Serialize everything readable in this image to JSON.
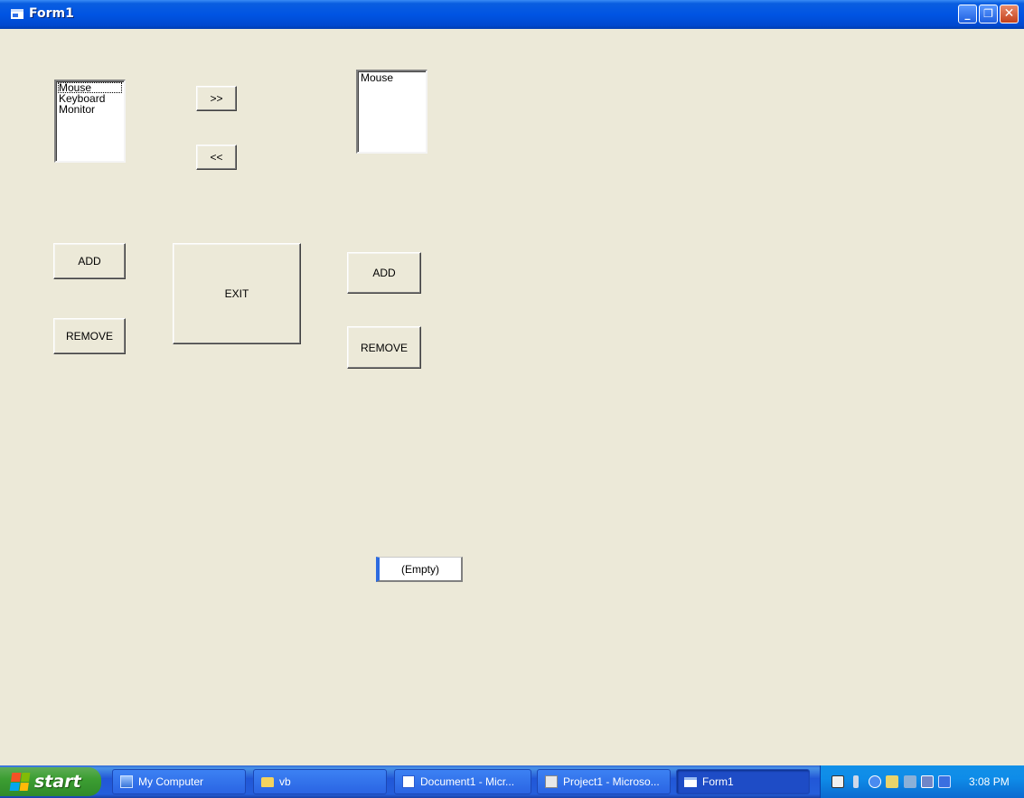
{
  "window": {
    "title": "Form1"
  },
  "form": {
    "left_list": {
      "items": [
        "Mouse",
        "Keyboard",
        "Monitor"
      ]
    },
    "right_list": {
      "items": [
        "Mouse"
      ]
    },
    "move_right_label": ">>",
    "move_left_label": "<<",
    "left_add_label": "ADD",
    "left_remove_label": "REMOVE",
    "exit_label": "EXIT",
    "right_add_label": "ADD",
    "right_remove_label": "REMOVE",
    "empty_box_text": "(Empty)"
  },
  "taskbar": {
    "start_label": "start",
    "tasks": [
      {
        "label": "My Computer",
        "icon": "computer-icon"
      },
      {
        "label": "vb",
        "icon": "folder-icon"
      },
      {
        "label": "Document1 - Micr...",
        "icon": "word-document-icon"
      },
      {
        "label": "Project1 - Microso...",
        "icon": "vb-project-icon"
      },
      {
        "label": "Form1",
        "icon": "form-icon",
        "active": true
      }
    ],
    "clock": "3:08 PM"
  }
}
